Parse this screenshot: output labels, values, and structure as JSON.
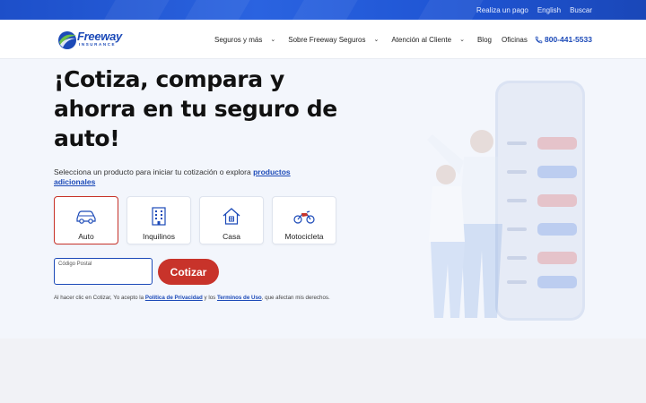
{
  "topbar": {
    "links": [
      "Realiza un pago",
      "English",
      "Buscar"
    ]
  },
  "brand": {
    "name": "Freeway",
    "tagline": "INSURANCE",
    "color": "#1c4ab8",
    "accent": "#c8332a"
  },
  "nav": {
    "items": [
      {
        "label": "Seguros y más",
        "dropdown": true
      },
      {
        "label": "Sobre Freeway Seguros",
        "dropdown": true
      },
      {
        "label": "Atención al Cliente",
        "dropdown": true
      },
      {
        "label": "Blog",
        "dropdown": false
      },
      {
        "label": "Oficinas",
        "dropdown": false
      }
    ],
    "phone": "800-441-5533"
  },
  "hero": {
    "headline": "¡Cotiza, compara y ahorra en tu seguro de auto!",
    "subtext": "Selecciona un producto para iniciar tu cotización o explora ",
    "subtext_link": "productos adicionales",
    "products": [
      {
        "label": "Auto",
        "icon": "car-icon",
        "selected": true
      },
      {
        "label": "Inquilinos",
        "icon": "building-icon",
        "selected": false
      },
      {
        "label": "Casa",
        "icon": "house-icon",
        "selected": false
      },
      {
        "label": "Motocicleta",
        "icon": "motorcycle-icon",
        "selected": false
      }
    ],
    "zip_label": "Código Postal",
    "zip_value": "",
    "cta": "Cotizar",
    "legal_1": "Al hacer clic en Cotizar, Yo acepto la ",
    "legal_link_1": "Política de Privacidad",
    "legal_2": " y los ",
    "legal_link_2": "Terminos de Uso",
    "legal_3": ", que afectan mis derechos."
  }
}
